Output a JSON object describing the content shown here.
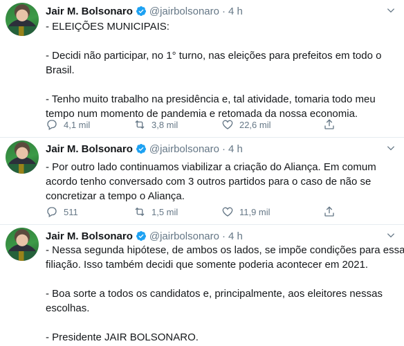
{
  "tweets": [
    {
      "author": "Jair M. Bolsonaro",
      "handle": "@jairbolsonaro",
      "separator": "·",
      "time": "4 h",
      "lines": [
        "- ELEIÇÕES MUNICIPAIS:",
        "",
        "- Decidi não participar, no 1° turno, nas eleições para prefeitos em todo o",
        "Brasil.",
        "",
        "- Tenho muito trabalho na presidência e, tal atividade, tomaria todo meu",
        "tempo num momento de pandemia e retomada da nossa economia."
      ],
      "replies": "4,1 mil",
      "retweets": "3,8 mil",
      "likes": "22,6 mil"
    },
    {
      "author": "Jair M. Bolsonaro",
      "handle": "@jairbolsonaro",
      "separator": "·",
      "time": "4 h",
      "lines": [
        "- Por outro lado continuamos viabilizar a criação do Aliança. Em comum",
        "acordo tenho conversado com 3 outros partidos para o caso de não se",
        "concretizar a tempo o Aliança."
      ],
      "replies": "511",
      "retweets": "1,5 mil",
      "likes": "11,9 mil"
    },
    {
      "author": "Jair M. Bolsonaro",
      "handle": "@jairbolsonaro",
      "separator": "·",
      "time": "4 h",
      "lines": [
        "- Nessa segunda hipótese, de ambos os lados, se impõe condições para essa",
        "filiação. Isso também decidi que somente poderia acontecer em 2021.",
        "",
        "- Boa sorte a todos os candidatos e, principalmente, aos eleitores nessas",
        "escolhas.",
        "",
        "- Presidente JAIR BOLSONARO."
      ]
    }
  ],
  "colors": {
    "verified": "#1da1f2",
    "muted": "#657786",
    "text": "#14171a",
    "divider": "#e6ecf0"
  },
  "icons": {
    "reply": "reply-icon",
    "retweet": "retweet-icon",
    "like": "like-icon",
    "share": "share-icon",
    "verified": "verified-badge-icon",
    "caret": "chevron-down-icon"
  }
}
